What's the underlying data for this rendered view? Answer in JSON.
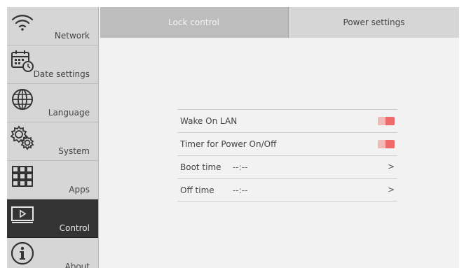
{
  "sidebar": {
    "items": [
      {
        "label": "Network",
        "icon": "wifi-icon",
        "active": false
      },
      {
        "label": "Date settings",
        "icon": "calendar-clock-icon",
        "active": false
      },
      {
        "label": "Language",
        "icon": "globe-icon",
        "active": false
      },
      {
        "label": "System",
        "icon": "gears-icon",
        "active": false
      },
      {
        "label": "Apps",
        "icon": "grid-icon",
        "active": false
      },
      {
        "label": "Control",
        "icon": "screen-play-icon",
        "active": true
      },
      {
        "label": "About",
        "icon": "info-icon",
        "active": false
      }
    ]
  },
  "tabs": [
    {
      "label": "Lock control",
      "active": false
    },
    {
      "label": "Power settings",
      "active": true
    }
  ],
  "settings": {
    "wake_on_lan": {
      "label": "Wake On LAN",
      "enabled": false
    },
    "timer_power": {
      "label": "Timer for Power On/Off",
      "enabled": false
    },
    "boot_time": {
      "label": "Boot time",
      "value": "--:--",
      "chevron": ">"
    },
    "off_time": {
      "label": "Off time",
      "value": "--:--",
      "chevron": ">"
    }
  },
  "colors": {
    "toggle_track": "#f3b8b8",
    "toggle_knob": "#ef6b6b",
    "sidebar_active": "#333333"
  }
}
